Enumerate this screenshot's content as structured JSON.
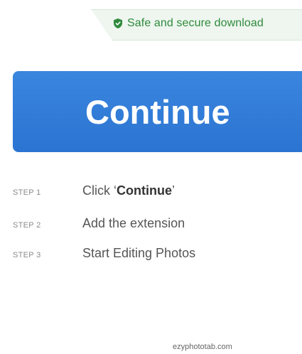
{
  "banner": {
    "icon": "shield-icon",
    "text": "Safe and secure download",
    "color": "#2f8a3c"
  },
  "cta": {
    "label": "Continue",
    "color": "#2b74d2"
  },
  "steps": [
    {
      "label": "STEP 1",
      "prefix": "Click ‘",
      "bold": "Continue",
      "suffix": "’"
    },
    {
      "label": "STEP 2",
      "text": "Add the extension"
    },
    {
      "label": "STEP 3",
      "text": "Start Editing Photos"
    }
  ],
  "footer": {
    "domain": "ezyphototab.com"
  }
}
